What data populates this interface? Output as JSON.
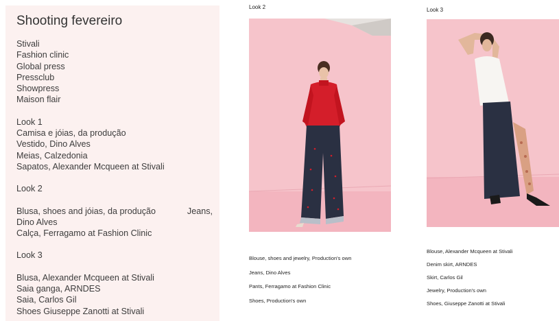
{
  "notes": {
    "title": "Shooting fevereiro",
    "brands": [
      "Stivali",
      "Fashion clinic",
      "Global press",
      "Pressclub",
      "Showpress",
      "Maison flair"
    ],
    "look1_heading": "Look 1",
    "look1_items": [
      "Camisa e jóias, da produção",
      "Vestido, Dino Alves",
      "Meias, Calzedonia",
      "Sapatos, Alexander Mcqueen at Stivali"
    ],
    "look2_heading": "Look 2",
    "look2_line1_left": "Blusa, shoes and jóias, da produção",
    "look2_line1_right": "Jeans,",
    "look2_line2": "Dino Alves",
    "look2_line3": "Calça, Ferragamo at Fashion Clinic",
    "look3_heading": "Look 3",
    "look3_items": [
      "Blusa, Alexander Mcqueen at Stivali",
      "Saia ganga,  ARNDES",
      "Saia, Carlos Gil",
      "Shoes Giuseppe Zanotti at Stivali"
    ]
  },
  "look2": {
    "label": "Look 2",
    "captions": [
      "Blouse, shoes and jewelry, Production's own",
      "Jeans, Dino Alves",
      "Pants, Ferragamo at Fashion Clinic",
      "Shoes, Production's own"
    ]
  },
  "look3": {
    "label": "Look 3",
    "captions": [
      "Blouse, Alexander Mcqueen at Stivali",
      "Denim skirt, ARNDES",
      "Skirt, Carlos Gil",
      "Jewelry, Production's own",
      "Shoes, Giuseppe Zanotti at Stivali"
    ]
  },
  "colors": {
    "notes_bg": "#fcf1f0",
    "backdrop_pink": "#f6c4cb",
    "floor_pink": "#f3b5bf",
    "turtleneck_red": "#d41e2a",
    "denim_navy": "#2a3042"
  }
}
